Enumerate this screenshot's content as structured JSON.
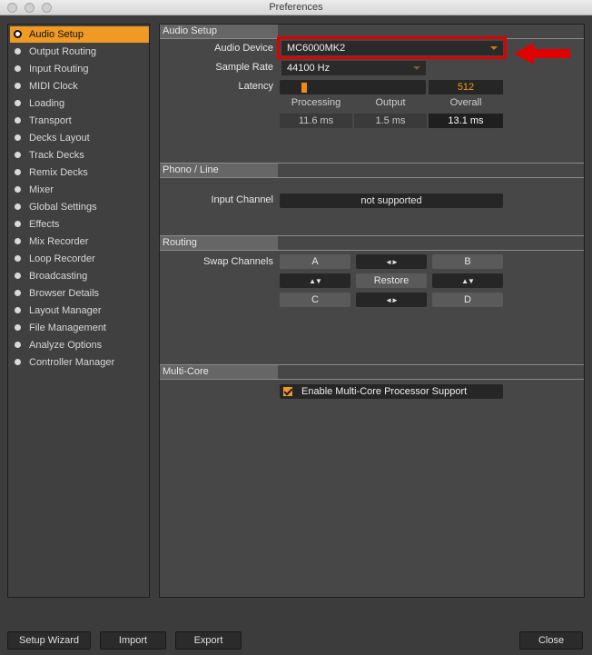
{
  "window": {
    "title": "Preferences"
  },
  "sidebar": {
    "items": [
      {
        "label": "Audio Setup",
        "active": true
      },
      {
        "label": "Output Routing"
      },
      {
        "label": "Input Routing"
      },
      {
        "label": "MIDI Clock"
      },
      {
        "label": "Loading"
      },
      {
        "label": "Transport"
      },
      {
        "label": "Decks Layout"
      },
      {
        "label": "Track Decks"
      },
      {
        "label": "Remix Decks"
      },
      {
        "label": "Mixer"
      },
      {
        "label": "Global Settings"
      },
      {
        "label": "Effects"
      },
      {
        "label": "Mix Recorder"
      },
      {
        "label": "Loop Recorder"
      },
      {
        "label": "Broadcasting"
      },
      {
        "label": "Browser Details"
      },
      {
        "label": "Layout Manager"
      },
      {
        "label": "File Management"
      },
      {
        "label": "Analyze Options"
      },
      {
        "label": "Controller Manager"
      }
    ]
  },
  "audio_setup": {
    "heading": "Audio Setup",
    "device_label": "Audio Device",
    "device_value": "MC6000MK2",
    "sample_rate_label": "Sample Rate",
    "sample_rate_value": "44100 Hz",
    "latency_label": "Latency",
    "latency_value": "512",
    "latency_slider_fraction": 0.05,
    "col_processing": "Processing",
    "col_output": "Output",
    "col_overall": "Overall",
    "processing_ms": "11.6 ms",
    "output_ms": "1.5 ms",
    "overall_ms": "13.1 ms"
  },
  "phono_line": {
    "heading": "Phono / Line",
    "input_channel_label": "Input Channel",
    "input_channel_value": "not supported"
  },
  "routing": {
    "heading": "Routing",
    "swap_label": "Swap Channels",
    "a": "A",
    "b": "B",
    "c": "C",
    "d": "D",
    "restore": "Restore",
    "swap_horizontal_glyph": "◄►",
    "swap_vertical_glyph": "▲▼"
  },
  "multicore": {
    "heading": "Multi-Core",
    "checkbox_label": "Enable Multi-Core Processor Support",
    "checked": true
  },
  "footer": {
    "setup_wizard": "Setup Wizard",
    "import": "Import",
    "export": "Export",
    "close": "Close"
  },
  "colors": {
    "accent_orange": "#f09a24",
    "annotation_red": "#e10000"
  }
}
